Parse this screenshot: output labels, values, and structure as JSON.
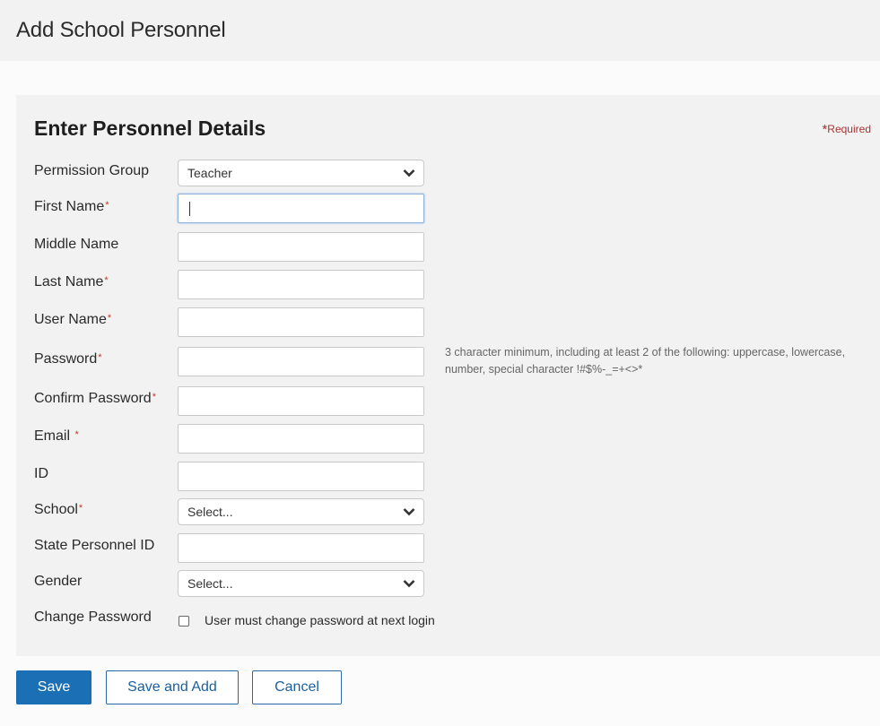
{
  "header": {
    "title": "Add School Personnel"
  },
  "form": {
    "title": "Enter Personnel Details",
    "required_note": {
      "star": "*",
      "text": "Required"
    },
    "fields": [
      {
        "label": "Permission Group",
        "required": false,
        "type": "select",
        "value": "Teacher"
      },
      {
        "label": "First Name",
        "required": true,
        "type": "text",
        "value": "",
        "focused": true
      },
      {
        "label": "Middle Name",
        "required": false,
        "type": "text",
        "value": ""
      },
      {
        "label": "Last Name",
        "required": true,
        "type": "text",
        "value": ""
      },
      {
        "label": "User Name",
        "required": true,
        "type": "text",
        "value": ""
      },
      {
        "label": "Password",
        "required": true,
        "type": "password",
        "value": ""
      },
      {
        "label": "Confirm Password",
        "required": true,
        "type": "password",
        "value": ""
      },
      {
        "label": "Email ",
        "required": true,
        "type": "text",
        "value": ""
      },
      {
        "label": "ID",
        "required": false,
        "type": "text",
        "value": ""
      },
      {
        "label": "School",
        "required": true,
        "type": "select",
        "value": "Select..."
      },
      {
        "label": "State Personnel ID",
        "required": false,
        "type": "text",
        "value": ""
      },
      {
        "label": "Gender",
        "required": false,
        "type": "select",
        "value": "Select..."
      }
    ],
    "required_marker": "*",
    "password_hint": "3 character minimum, including at least 2 of the following: uppercase, lowercase, number, special character !#$%-_=+<>*",
    "change_password": {
      "label": "Change Password",
      "checkbox_label": "User must change password at next login",
      "checked": false
    }
  },
  "buttons": {
    "save": "Save",
    "save_and_add": "Save and Add",
    "cancel": "Cancel"
  },
  "colors": {
    "primary": "#1a6fb5",
    "required": "#c0392b"
  }
}
